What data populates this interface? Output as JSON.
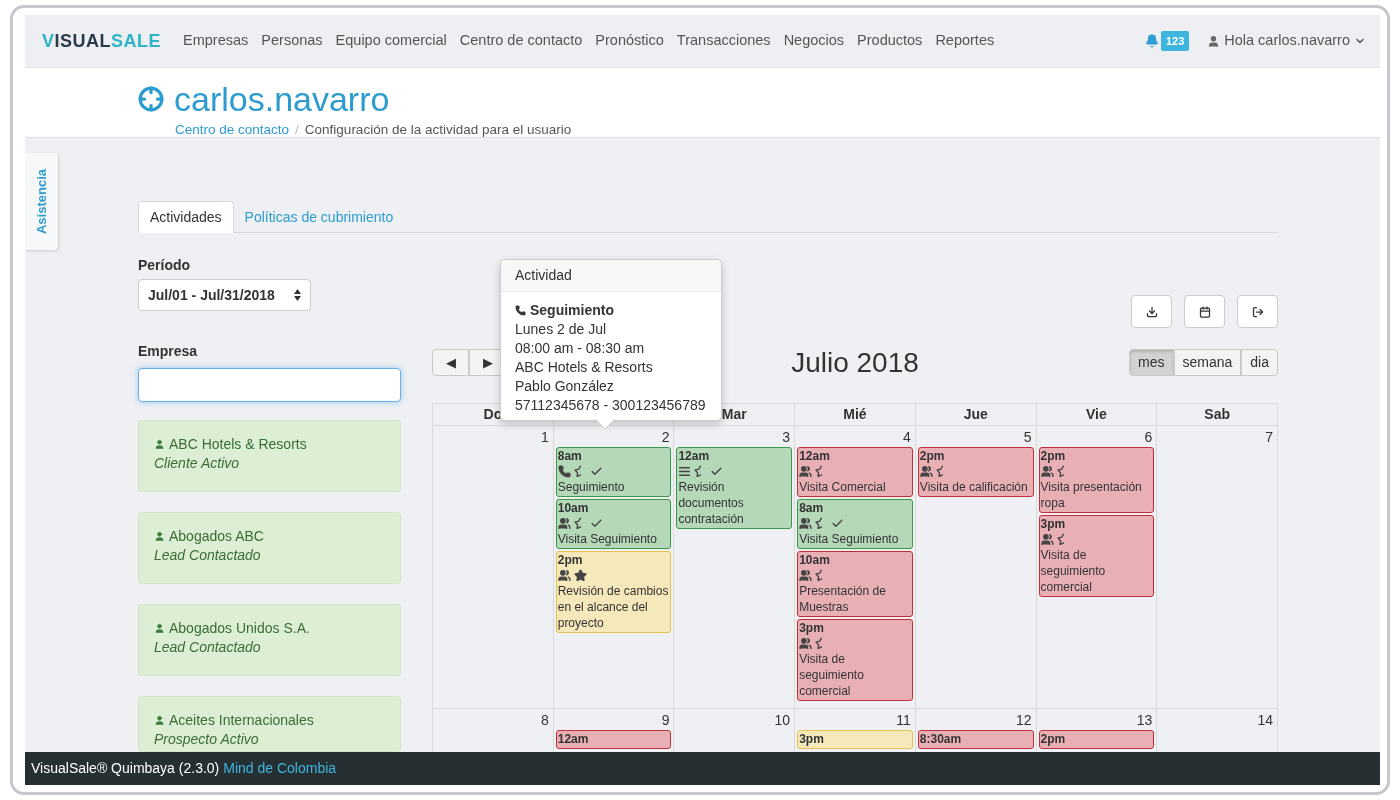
{
  "navbar": {
    "logo": [
      {
        "text": "V",
        "accent": true
      },
      {
        "text": "ISUAL",
        "accent": false
      },
      {
        "text": "SALE",
        "accent": true
      }
    ],
    "links": [
      "Empresas",
      "Personas",
      "Equipo comercial",
      "Centro de contacto",
      "Pronóstico",
      "Transacciones",
      "Negocios",
      "Productos",
      "Reportes"
    ],
    "notifications": "123",
    "user": "Hola carlos.navarro"
  },
  "header": {
    "title": "carlos.navarro",
    "breadcrumb_separator": "/",
    "breadcrumb": [
      {
        "text": "Centro de contacto",
        "link": true
      },
      {
        "text": "Configuración de la actividad para el usuario",
        "link": false
      }
    ]
  },
  "side_tab": "Asistencia",
  "tabs": [
    {
      "label": "Actividades",
      "selected": true
    },
    {
      "label": "Políticas de cubrimiento",
      "selected": false
    }
  ],
  "period": {
    "label": "Período",
    "value": "Jul/01 - Jul/31/2018"
  },
  "company": {
    "label": "Empresa",
    "focused": true
  },
  "companies": [
    {
      "name": "ABC Hotels & Resorts",
      "status": "Cliente Activo"
    },
    {
      "name": "Abogados ABC",
      "status": "Lead Contactado"
    },
    {
      "name": "Abogados Unidos S.A.",
      "status": "Lead Contactado"
    },
    {
      "name": "Aceites Internacionales",
      "status": "Prospecto Activo"
    }
  ],
  "calendar": {
    "title": "Julio 2018",
    "nav": [
      "◀",
      "▶"
    ],
    "views": [
      {
        "label": "mes",
        "selected": true
      },
      {
        "label": "semana",
        "selected": false
      },
      {
        "label": "dia",
        "selected": false
      }
    ],
    "day_headers": [
      {
        "label": "Do",
        "after_gap": false
      },
      {
        "label": "Mar",
        "after_gap": true
      },
      {
        "label": "Mié",
        "after_gap": false
      },
      {
        "label": "Jue",
        "after_gap": false
      },
      {
        "label": "Vie",
        "after_gap": false
      },
      {
        "label": "Sab",
        "after_gap": false
      }
    ],
    "weeks": [
      [
        {
          "day": "1"
        },
        {
          "day": "2",
          "events": [
            {
              "time": "8am",
              "color": "#3b9848",
              "kind": "call",
              "starred": false,
              "completed": true,
              "title": "Seguimiento"
            },
            {
              "time": "10am",
              "color": "#3b9848",
              "kind": "meeting",
              "starred": false,
              "completed": true,
              "title": "Visita Seguimiento"
            },
            {
              "time": "2pm",
              "color": "#e5c24a",
              "kind": "meeting",
              "starred": true,
              "completed": false,
              "title": "Revisión de cambios en el alcance del proyecto"
            }
          ]
        },
        {
          "day": "3",
          "events": [
            {
              "time": "12am",
              "color": "#3b9848",
              "kind": "task",
              "starred": false,
              "completed": true,
              "title": "Revisión documentos contratación"
            }
          ]
        },
        {
          "day": "4",
          "events": [
            {
              "time": "12am",
              "color": "#c22f3b",
              "kind": "meeting",
              "starred": false,
              "completed": false,
              "title": "Visita Comercial"
            },
            {
              "time": "8am",
              "color": "#3b9848",
              "kind": "meeting",
              "starred": false,
              "completed": true,
              "title": "Visita Seguimiento"
            },
            {
              "time": "10am",
              "color": "#c22f3b",
              "kind": "meeting",
              "starred": false,
              "completed": false,
              "title": "Presentación de Muestras"
            },
            {
              "time": "3pm",
              "color": "#c22f3b",
              "kind": "meeting",
              "starred": false,
              "completed": false,
              "title": "Visita de seguimiento comercial"
            }
          ]
        },
        {
          "day": "5",
          "events": [
            {
              "time": "2pm",
              "color": "#c22f3b",
              "kind": "meeting",
              "starred": false,
              "completed": false,
              "title": "Visita de calificación"
            }
          ]
        },
        {
          "day": "6",
          "events": [
            {
              "time": "2pm",
              "color": "#c22f3b",
              "kind": "meeting",
              "starred": false,
              "completed": false,
              "title": "Visita presentación ropa"
            },
            {
              "time": "3pm",
              "color": "#c22f3b",
              "kind": "meeting",
              "starred": false,
              "completed": false,
              "title": "Visita de seguimiento comercial"
            }
          ]
        },
        {
          "day": "7"
        }
      ],
      [
        {
          "day": "8"
        },
        {
          "day": "9",
          "events": [
            {
              "time": "12am",
              "color": "#c22f3b"
            }
          ]
        },
        {
          "day": "10"
        },
        {
          "day": "11",
          "events": [
            {
              "time": "3pm",
              "color": "#e5c24a"
            }
          ]
        },
        {
          "day": "12",
          "events": [
            {
              "time": "8:30am",
              "color": "#c22f3b"
            }
          ]
        },
        {
          "day": "13",
          "events": [
            {
              "time": "2pm",
              "color": "#c22f3b"
            }
          ]
        },
        {
          "day": "14"
        }
      ]
    ]
  },
  "popover": {
    "header": "Actividad",
    "title": "Seguimiento",
    "lines": [
      "Lunes 2 de Jul",
      "08:00 am - 08:30 am",
      "ABC Hotels & Resorts",
      "Pablo González",
      "57112345678 - 300123456789"
    ]
  },
  "footer": {
    "text": "VisualSale® Quimbaya (2.3.0)",
    "link": "Mind de Colombia"
  }
}
